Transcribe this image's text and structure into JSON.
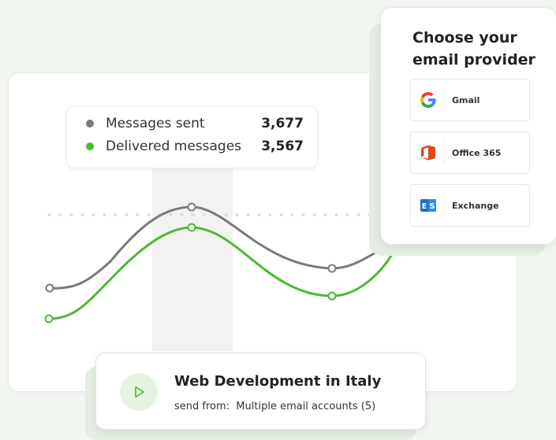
{
  "legend": {
    "items": [
      {
        "label": "Messages sent",
        "value": "3,677",
        "color": "#7a7a80"
      },
      {
        "label": "Delivered messages",
        "value": "3,567",
        "color": "#4cb834"
      }
    ]
  },
  "provider_panel": {
    "title": "Choose your email provider",
    "options": [
      {
        "name": "Gmail",
        "icon": "google-icon"
      },
      {
        "name": "Office 365",
        "icon": "office-icon"
      },
      {
        "name": "Exchange",
        "icon": "exchange-icon"
      }
    ]
  },
  "campaign": {
    "title": "Web Development in Italy",
    "send_from_label": "send from:",
    "send_from_value": "Multiple email accounts (5)",
    "icon": "play-icon"
  },
  "colors": {
    "sent": "#7a7a80",
    "delivered": "#4cb834",
    "accent_green": "#4cb834"
  }
}
